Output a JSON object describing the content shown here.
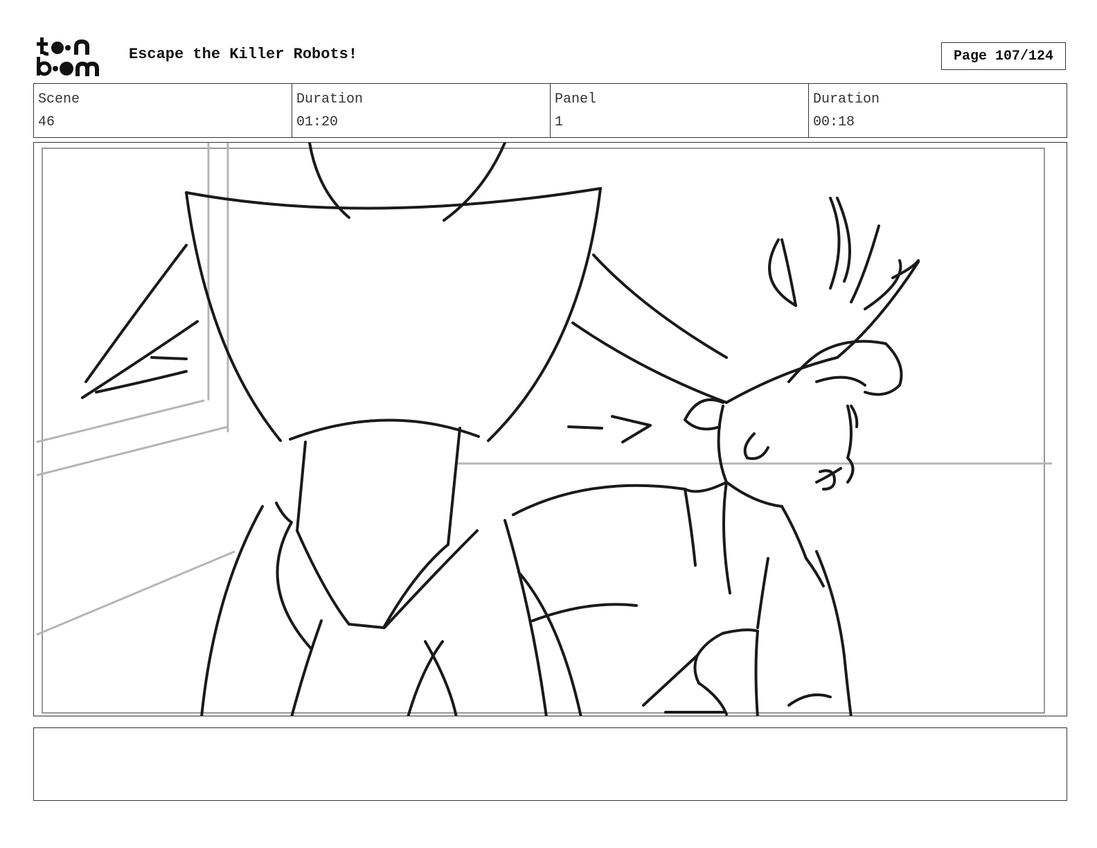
{
  "header": {
    "logo_text_top": "toon",
    "logo_text_bottom": "boom",
    "title": "Escape the Killer Robots!",
    "page_label": "Page 107/124"
  },
  "info": {
    "scene_label": "Scene",
    "scene_value": "46",
    "duration_label": "Duration",
    "duration_value": "01:20",
    "panel_label": "Panel",
    "panel_value": "1",
    "panel_duration_label": "Duration",
    "panel_duration_value": "00:18"
  },
  "notes": {
    "text": ""
  }
}
